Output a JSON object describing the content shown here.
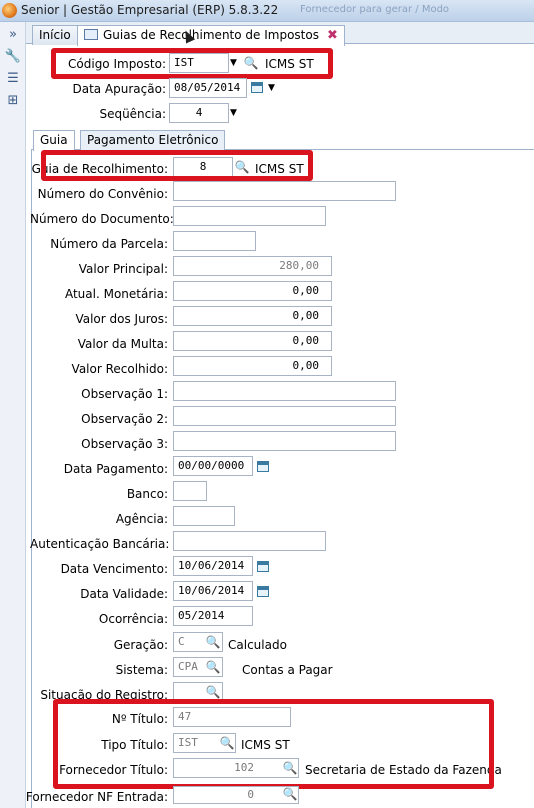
{
  "window": {
    "title": "Senior | Gestão Empresarial (ERP) 5.8.3.22",
    "ghost_title": "Fornecedor para gerar / Modo"
  },
  "tabs": [
    {
      "label": "Início"
    },
    {
      "label": "Guias de Recolhimento de Impostos",
      "close": "✖"
    }
  ],
  "header": {
    "codigo_imposto": {
      "label": "Código Imposto:",
      "value": "IST",
      "desc": "ICMS ST"
    },
    "data_apuracao": {
      "label": "Data Apuração:",
      "value": "08/05/2014"
    },
    "sequencia": {
      "label": "Seqüência:",
      "value": "4"
    }
  },
  "subtabs": [
    {
      "label": "Guia"
    },
    {
      "label": "Pagamento Eletrônico"
    }
  ],
  "form": {
    "guia": {
      "label": "Guia de Recolhimento:",
      "value": "8",
      "desc": "ICMS ST"
    },
    "numero_convenio": {
      "label": "Número do Convênio:",
      "value": ""
    },
    "numero_documento": {
      "label": "Número do Documento:",
      "value": ""
    },
    "numero_parcela": {
      "label": "Número da Parcela:",
      "value": ""
    },
    "valor_principal": {
      "label": "Valor Principal:",
      "value": "280,00"
    },
    "atual_monetaria": {
      "label": "Atual. Monetária:",
      "value": "0,00"
    },
    "valor_juros": {
      "label": "Valor dos Juros:",
      "value": "0,00"
    },
    "valor_multa": {
      "label": "Valor da Multa:",
      "value": "0,00"
    },
    "valor_recolhido": {
      "label": "Valor Recolhido:",
      "value": "0,00"
    },
    "obs1": {
      "label": "Observação 1:",
      "value": ""
    },
    "obs2": {
      "label": "Observação 2:",
      "value": ""
    },
    "obs3": {
      "label": "Observação 3:",
      "value": ""
    },
    "data_pagamento": {
      "label": "Data Pagamento:",
      "value": "00/00/0000"
    },
    "banco": {
      "label": "Banco:",
      "value": ""
    },
    "agencia": {
      "label": "Agência:",
      "value": ""
    },
    "autenticacao": {
      "label": "Autenticação Bancária:",
      "value": ""
    },
    "data_vencimento": {
      "label": "Data Vencimento:",
      "value": "10/06/2014"
    },
    "data_validade": {
      "label": "Data Validade:",
      "value": "10/06/2014"
    },
    "ocorrencia": {
      "label": "Ocorrência:",
      "value": "05/2014"
    },
    "geracao": {
      "label": "Geração:",
      "value": "C",
      "desc": "Calculado"
    },
    "sistema": {
      "label": "Sistema:",
      "value": "CPA",
      "desc": "Contas a Pagar"
    },
    "situacao_registro": {
      "label": "Situação do Registro:",
      "value": ""
    },
    "nr_titulo": {
      "label": "Nº Título:",
      "value": "47"
    },
    "tipo_titulo": {
      "label": "Tipo Título:",
      "value": "IST",
      "desc": "ICMS ST"
    },
    "fornecedor_titulo": {
      "label": "Fornecedor Título:",
      "value": "102",
      "desc": "Secretaria de Estado da Fazenda"
    },
    "fornecedor_nf": {
      "label": "Fornecedor NF Entrada:",
      "value": "0"
    }
  },
  "colors": {
    "highlight": "#d9141e",
    "accent": "#3a7aa0"
  },
  "icons": [
    "app-icon",
    "expand-icon",
    "wrench-icon",
    "list-icon",
    "tree-icon",
    "search-icon",
    "calendar-icon",
    "dropdown-arrow-icon",
    "close-icon"
  ]
}
